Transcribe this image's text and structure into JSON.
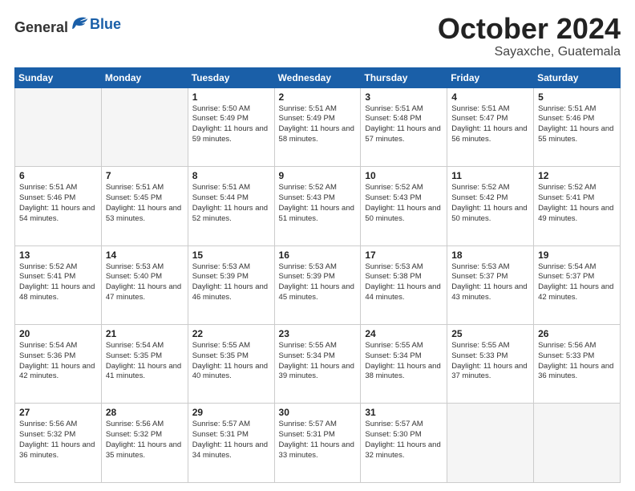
{
  "header": {
    "logo_general": "General",
    "logo_blue": "Blue",
    "month": "October 2024",
    "location": "Sayaxche, Guatemala"
  },
  "weekdays": [
    "Sunday",
    "Monday",
    "Tuesday",
    "Wednesday",
    "Thursday",
    "Friday",
    "Saturday"
  ],
  "weeks": [
    [
      {
        "day": "",
        "info": ""
      },
      {
        "day": "",
        "info": ""
      },
      {
        "day": "1",
        "info": "Sunrise: 5:50 AM\nSunset: 5:49 PM\nDaylight: 11 hours and 59 minutes."
      },
      {
        "day": "2",
        "info": "Sunrise: 5:51 AM\nSunset: 5:49 PM\nDaylight: 11 hours and 58 minutes."
      },
      {
        "day": "3",
        "info": "Sunrise: 5:51 AM\nSunset: 5:48 PM\nDaylight: 11 hours and 57 minutes."
      },
      {
        "day": "4",
        "info": "Sunrise: 5:51 AM\nSunset: 5:47 PM\nDaylight: 11 hours and 56 minutes."
      },
      {
        "day": "5",
        "info": "Sunrise: 5:51 AM\nSunset: 5:46 PM\nDaylight: 11 hours and 55 minutes."
      }
    ],
    [
      {
        "day": "6",
        "info": "Sunrise: 5:51 AM\nSunset: 5:46 PM\nDaylight: 11 hours and 54 minutes."
      },
      {
        "day": "7",
        "info": "Sunrise: 5:51 AM\nSunset: 5:45 PM\nDaylight: 11 hours and 53 minutes."
      },
      {
        "day": "8",
        "info": "Sunrise: 5:51 AM\nSunset: 5:44 PM\nDaylight: 11 hours and 52 minutes."
      },
      {
        "day": "9",
        "info": "Sunrise: 5:52 AM\nSunset: 5:43 PM\nDaylight: 11 hours and 51 minutes."
      },
      {
        "day": "10",
        "info": "Sunrise: 5:52 AM\nSunset: 5:43 PM\nDaylight: 11 hours and 50 minutes."
      },
      {
        "day": "11",
        "info": "Sunrise: 5:52 AM\nSunset: 5:42 PM\nDaylight: 11 hours and 50 minutes."
      },
      {
        "day": "12",
        "info": "Sunrise: 5:52 AM\nSunset: 5:41 PM\nDaylight: 11 hours and 49 minutes."
      }
    ],
    [
      {
        "day": "13",
        "info": "Sunrise: 5:52 AM\nSunset: 5:41 PM\nDaylight: 11 hours and 48 minutes."
      },
      {
        "day": "14",
        "info": "Sunrise: 5:53 AM\nSunset: 5:40 PM\nDaylight: 11 hours and 47 minutes."
      },
      {
        "day": "15",
        "info": "Sunrise: 5:53 AM\nSunset: 5:39 PM\nDaylight: 11 hours and 46 minutes."
      },
      {
        "day": "16",
        "info": "Sunrise: 5:53 AM\nSunset: 5:39 PM\nDaylight: 11 hours and 45 minutes."
      },
      {
        "day": "17",
        "info": "Sunrise: 5:53 AM\nSunset: 5:38 PM\nDaylight: 11 hours and 44 minutes."
      },
      {
        "day": "18",
        "info": "Sunrise: 5:53 AM\nSunset: 5:37 PM\nDaylight: 11 hours and 43 minutes."
      },
      {
        "day": "19",
        "info": "Sunrise: 5:54 AM\nSunset: 5:37 PM\nDaylight: 11 hours and 42 minutes."
      }
    ],
    [
      {
        "day": "20",
        "info": "Sunrise: 5:54 AM\nSunset: 5:36 PM\nDaylight: 11 hours and 42 minutes."
      },
      {
        "day": "21",
        "info": "Sunrise: 5:54 AM\nSunset: 5:35 PM\nDaylight: 11 hours and 41 minutes."
      },
      {
        "day": "22",
        "info": "Sunrise: 5:55 AM\nSunset: 5:35 PM\nDaylight: 11 hours and 40 minutes."
      },
      {
        "day": "23",
        "info": "Sunrise: 5:55 AM\nSunset: 5:34 PM\nDaylight: 11 hours and 39 minutes."
      },
      {
        "day": "24",
        "info": "Sunrise: 5:55 AM\nSunset: 5:34 PM\nDaylight: 11 hours and 38 minutes."
      },
      {
        "day": "25",
        "info": "Sunrise: 5:55 AM\nSunset: 5:33 PM\nDaylight: 11 hours and 37 minutes."
      },
      {
        "day": "26",
        "info": "Sunrise: 5:56 AM\nSunset: 5:33 PM\nDaylight: 11 hours and 36 minutes."
      }
    ],
    [
      {
        "day": "27",
        "info": "Sunrise: 5:56 AM\nSunset: 5:32 PM\nDaylight: 11 hours and 36 minutes."
      },
      {
        "day": "28",
        "info": "Sunrise: 5:56 AM\nSunset: 5:32 PM\nDaylight: 11 hours and 35 minutes."
      },
      {
        "day": "29",
        "info": "Sunrise: 5:57 AM\nSunset: 5:31 PM\nDaylight: 11 hours and 34 minutes."
      },
      {
        "day": "30",
        "info": "Sunrise: 5:57 AM\nSunset: 5:31 PM\nDaylight: 11 hours and 33 minutes."
      },
      {
        "day": "31",
        "info": "Sunrise: 5:57 AM\nSunset: 5:30 PM\nDaylight: 11 hours and 32 minutes."
      },
      {
        "day": "",
        "info": ""
      },
      {
        "day": "",
        "info": ""
      }
    ]
  ]
}
